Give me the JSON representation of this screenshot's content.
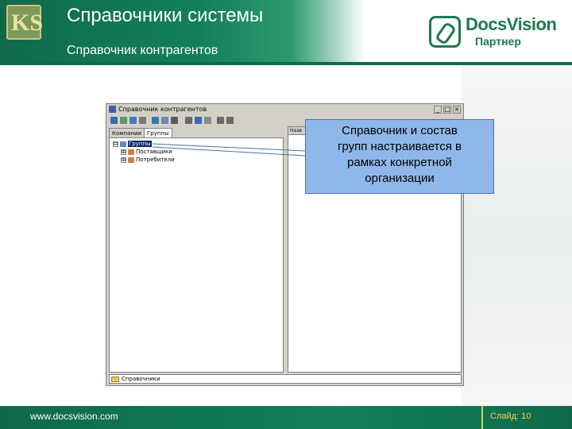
{
  "slide": {
    "title": "Справочники системы",
    "subtitle": "Справочник контрагентов",
    "logo_text": "KS",
    "brand": {
      "name": "DocsVision",
      "tagline": "Партнер"
    },
    "accent_color": "#0f6a4a"
  },
  "window": {
    "title": "Справочник контрагентов",
    "buttons": [
      "_",
      "□",
      "×"
    ],
    "tabs": [
      "Компании",
      "Группы"
    ],
    "active_tab": "Группы",
    "tree": [
      {
        "label": "Группы",
        "expander": "⊟",
        "selected": true
      },
      {
        "label": "Поставщики",
        "expander": "⊞",
        "selected": false
      },
      {
        "label": "Потребители",
        "expander": "⊞",
        "selected": false
      }
    ],
    "right_column_header": "Назв",
    "bottom_label": "Справочники"
  },
  "callout": {
    "lines": [
      "Справочник и состав",
      "групп настраивается в",
      "рамках конкретной",
      "организации"
    ]
  },
  "footer": {
    "url": "www.docsvision.com",
    "slide_label": "Слайд: 10"
  }
}
